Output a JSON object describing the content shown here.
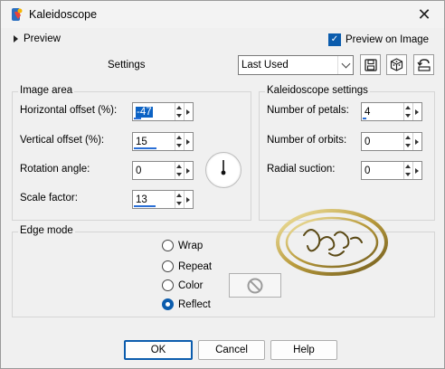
{
  "window": {
    "title": "Kaleidoscope"
  },
  "top": {
    "preview_label": "Preview",
    "preview_on_image_label": "Preview on Image",
    "preview_on_image_checked": true,
    "settings_label": "Settings",
    "settings_value": "Last Used"
  },
  "image_area": {
    "title": "Image area",
    "fields": [
      {
        "label": "Horizontal offset (%):",
        "value": "-47",
        "fill": 0.18
      },
      {
        "label": "Vertical offset (%):",
        "value": "15",
        "fill": 0.57
      },
      {
        "label": "Rotation angle:",
        "value": "0",
        "fill": 0
      },
      {
        "label": "Scale factor:",
        "value": "13",
        "fill": 0.55
      }
    ]
  },
  "kaleidoscope_settings": {
    "title": "Kaleidoscope settings",
    "fields": [
      {
        "label": "Number of petals:",
        "value": "4",
        "fill": 0.08
      },
      {
        "label": "Number of orbits:",
        "value": "0",
        "fill": 0
      },
      {
        "label": "Radial suction:",
        "value": "0",
        "fill": 0
      }
    ]
  },
  "edge_mode": {
    "title": "Edge mode",
    "options": [
      "Wrap",
      "Repeat",
      "Color",
      "Reflect"
    ],
    "selected": "Reflect"
  },
  "buttons": {
    "ok": "OK",
    "cancel": "Cancel",
    "help": "Help"
  },
  "colors": {
    "accent": "#0b5cad",
    "selection": "#0b62c4",
    "window_bg": "#f0f0f0"
  },
  "icons": [
    "app-icon",
    "close-icon",
    "save-preset-icon",
    "cube-icon",
    "reset-icon",
    "no-color-icon",
    "watermark-logo"
  ]
}
